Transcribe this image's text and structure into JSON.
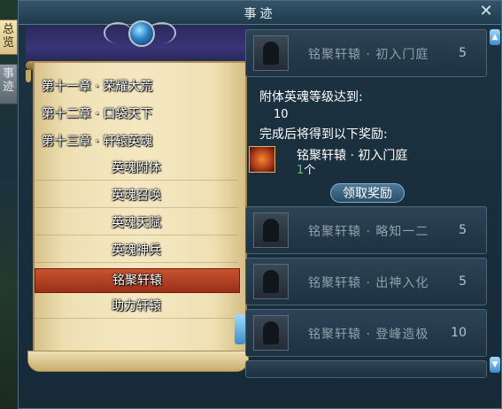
{
  "window": {
    "title": "事迹"
  },
  "side_tabs": [
    {
      "label": "总览"
    },
    {
      "label": "事迹"
    }
  ],
  "chapters": [
    {
      "label": "第十一章 · 荣耀大荒"
    },
    {
      "label": "第十二章 · 口袋天下"
    },
    {
      "label": "第十三章 · 轩辕英魂"
    }
  ],
  "sub_items": [
    {
      "label": "英魂附体"
    },
    {
      "label": "英魂召唤"
    },
    {
      "label": "英魂天赋"
    },
    {
      "label": "英魂神兵"
    },
    {
      "label": "铭聚轩辕",
      "selected": true
    },
    {
      "label": "助力轩辕"
    }
  ],
  "achievements": [
    {
      "name": "铭聚轩辕 · 初入门庭",
      "value": "5",
      "expanded": true
    },
    {
      "name": "铭聚轩辕 · 略知一二",
      "value": "5"
    },
    {
      "name": "铭聚轩辕 · 出神入化",
      "value": "5"
    },
    {
      "name": "铭聚轩辕 · 登峰造极",
      "value": "10"
    }
  ],
  "detail": {
    "requirement_label": "附体英魂等级达到:",
    "requirement_value": "10",
    "reward_label": "完成后将得到以下奖励:",
    "reward_name": "铭聚轩辕 ·  初入门庭",
    "reward_count": "1",
    "reward_unit": "个",
    "claim_button": "领取奖励"
  },
  "colors": {
    "selected_row": "#b8452a",
    "count_green": "#3fe03a",
    "panel_bg": "#1c3342"
  }
}
